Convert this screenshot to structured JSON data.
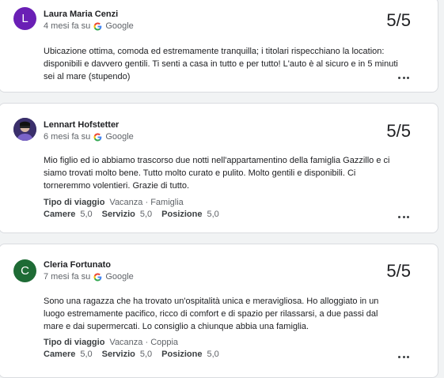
{
  "reviews": [
    {
      "author": "Laura Maria Cenzi",
      "avatar_letter": "L",
      "avatar_color": "#6a1fb5",
      "time": "4 mesi fa su",
      "source": "Google",
      "score": "5/5",
      "text": "Ubicazione ottima, comoda ed estremamente tranquilla; i titolari rispecchiano la location: disponibili e davvero gentili. Ti senti a casa in tutto e per tutto! L'auto è al sicuro e in 5 minuti sei al mare (stupendo)"
    },
    {
      "author": "Lennart Hofstetter",
      "avatar_letter": "",
      "avatar_color": "#2b2e5e",
      "time": "6 mesi fa su",
      "source": "Google",
      "score": "5/5",
      "text": "Mio figlio ed io abbiamo trascorso due notti nell'appartamentino della famiglia Gazzillo e ci siamo trovati molto bene. Tutto molto curato e pulito. Molto gentili e disponibili. Ci torneremmo volentieri. Grazie di tutto.",
      "trip_label": "Tipo di viaggio",
      "trip_value": "Vacanza · Famiglia",
      "ratings": [
        {
          "label": "Camere",
          "value": "5,0"
        },
        {
          "label": "Servizio",
          "value": "5,0"
        },
        {
          "label": "Posizione",
          "value": "5,0"
        }
      ]
    },
    {
      "author": "Cleria Fortunato",
      "avatar_letter": "C",
      "avatar_color": "#1e6b35",
      "time": "7 mesi fa su",
      "source": "Google",
      "score": "5/5",
      "text": "Sono una ragazza che ha trovato un'ospitalità unica e meravigliosa. Ho alloggiato in un luogo estremamente pacifico, ricco di comfort e di spazio per rilassarsi, a due passi dal mare e dai supermercati. Lo consiglio a chiunque abbia una famiglia.",
      "trip_label": "Tipo di viaggio",
      "trip_value": "Vacanza · Coppia",
      "ratings": [
        {
          "label": "Camere",
          "value": "5,0"
        },
        {
          "label": "Servizio",
          "value": "5,0"
        },
        {
          "label": "Posizione",
          "value": "5,0"
        }
      ]
    }
  ]
}
